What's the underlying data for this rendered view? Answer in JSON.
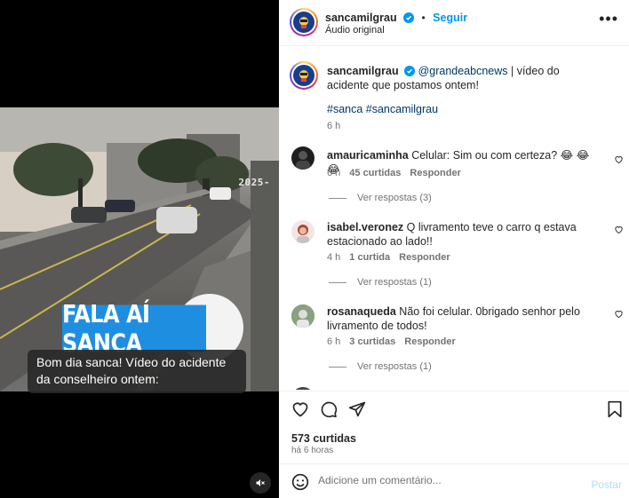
{
  "media": {
    "timestamp": "2025-",
    "banner": "FALA AÍ SANCA",
    "caption": "Bom dia sanca! Vídeo do acidente da conselheiro ontem:",
    "mute_icon": "speaker-muted-icon"
  },
  "header": {
    "username": "sancamilgrau",
    "follow": "Seguir",
    "audio": "Áudio original",
    "more_icon": "more-options-icon"
  },
  "post": {
    "username": "sancamilgrau",
    "mention": "@grandeabcnews",
    "text": " | vídeo do acidente que postamos ontem!",
    "hashtags": "#sanca #sancamilgrau",
    "time": "6 h"
  },
  "comments": [
    {
      "username": "amauricaminha",
      "text": "Celular: Sim ou com certeza? 😂 😂 😂",
      "time": "6 h",
      "likes": "45 curtidas",
      "reply": "Responder",
      "view_replies": "Ver respostas (3)"
    },
    {
      "username": "isabel.veronez",
      "text": "Q livramento teve o carro q estava estacionado ao lado!!",
      "time": "4 h",
      "likes": "1 curtida",
      "reply": "Responder",
      "view_replies": "Ver respostas (1)"
    },
    {
      "username": "rosanaqueda",
      "text": "Não foi celular. 0brigado senhor pelo livramento de todos!",
      "time": "6 h",
      "likes": "3 curtidas",
      "reply": "Responder",
      "view_replies": "Ver respostas (1)"
    }
  ],
  "actions": {
    "likes": "573 curtidas",
    "posted": "há 6 horas"
  },
  "composer": {
    "placeholder": "Adicione um comentário...",
    "post_label": "Postar"
  },
  "colors": {
    "accent": "#0095f6",
    "banner": "#1e8fe0",
    "link": "#00376b"
  }
}
